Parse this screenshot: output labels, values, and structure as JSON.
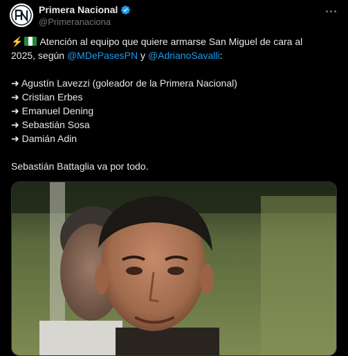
{
  "author": {
    "display_name": "Primera Nacional",
    "handle": "@Primeranaciona",
    "verified": true,
    "avatar_icon": "pn-logo-icon"
  },
  "tweet": {
    "line1_prefix_icons": [
      "lightning-icon",
      "nigeria-flag-icon"
    ],
    "line1": "Atención al equipo que quiere armarse San Miguel de cara al",
    "line2_pre": "2025, según ",
    "mention1": "@MDePasesPN",
    "line2_mid": " y ",
    "mention2": "@AdrianoSavalli",
    "line2_post": ":",
    "players": [
      "➜ Agustín Lavezzi (goleador de la Primera Nacional)",
      "➜ Cristian Erbes",
      "➜ Emanuel Dening",
      "➜ Sebastián Sosa",
      "➜ Damián Adin"
    ],
    "closing": "Sebastián Battaglia va por todo."
  },
  "colors": {
    "background": "#000000",
    "text": "#e7e9ea",
    "secondary": "#71767b",
    "link": "#1d9bf0",
    "verified": "#1d9bf0"
  }
}
